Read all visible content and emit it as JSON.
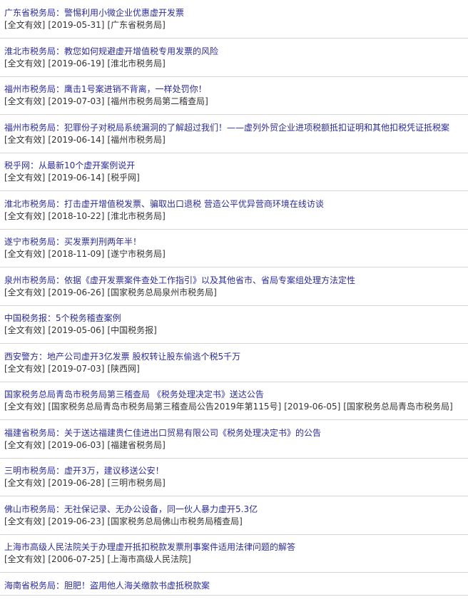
{
  "items": [
    {
      "title": "广东省税务局：警惕利用小微企业优惠虚开发票",
      "status": "[全文有效]",
      "date": "[2019-05-31]",
      "source": "[广东省税务局]"
    },
    {
      "title": "淮北市税务局：教您如何规避虚开增值税专用发票的风险",
      "status": "[全文有效]",
      "date": "[2019-06-19]",
      "source": "[淮北市税务局]"
    },
    {
      "title": "福州市税务局：鹰击1号案进销不背离，一样处罚你！",
      "status": "[全文有效]",
      "date": "[2019-07-03]",
      "source": "[福州市税务局第二稽查局]"
    },
    {
      "title": "福州市税务局：犯罪份子对税局系统漏洞的了解超过我们！——虚列外贸企业进项税额抵扣证明和其他扣税凭证抵税案",
      "status": "[全文有效]",
      "date": "[2019-06-14]",
      "source": "[福州市税务局]"
    },
    {
      "title": "税乎网：从最新10个虚开案例说开",
      "status": "[全文有效]",
      "date": "[2019-06-14]",
      "source": "[税乎网]"
    },
    {
      "title": "淮北市税务局：打击虚开增值税发票、骗取出口退税 营造公平优异营商环境在线访谈",
      "status": "[全文有效]",
      "date": "[2018-10-22]",
      "source": "[淮北市税务局]"
    },
    {
      "title": "遂宁市税务局：买发票判刑两年半！",
      "status": "[全文有效]",
      "date": "[2018-11-09]",
      "source": "[遂宁市税务局]"
    },
    {
      "title": "泉州市税务局：依据《虚开发票案件查处工作指引》以及其他省市、省局专案组处理方法定性",
      "status": "[全文有效]",
      "date": "[2019-06-26]",
      "source": "[国家税务总局泉州市税务局]"
    },
    {
      "title": "中国税务报：5个税务稽查案例",
      "status": "[全文有效]",
      "date": "[2019-05-06]",
      "source": "[中国税务报]"
    },
    {
      "title": "西安警方：地产公司虚开3亿发票 股权转让股东偷逃个税5千万",
      "status": "[全文有效]",
      "date": "[2019-07-03]",
      "source": "[陕西网]"
    },
    {
      "title": "国家税务总局青岛市税务局第三稽查局 《税务处理决定书》送达公告",
      "status": "[全文有效]",
      "extra": "[国家税务总局青岛市税务局第三稽查局公告2019年第115号]",
      "date": "[2019-06-05]",
      "source": "[国家税务总局青岛市税务局]"
    },
    {
      "title": "福建省税务局：关于送达福建贵仁佳进出口贸易有限公司《税务处理决定书》的公告",
      "status": "[全文有效]",
      "date": "[2019-06-03]",
      "source": "[福建省税务局]"
    },
    {
      "title": "三明市税务局：虚开3万，建议移送公安！",
      "status": "[全文有效]",
      "date": "[2019-06-28]",
      "source": "[三明市税务局]"
    },
    {
      "title": "佛山市税务局：无社保记录、无办公设备，同一伙人暴力虚开5.3亿",
      "status": "[全文有效]",
      "date": "[2019-06-23]",
      "source": "[国家税务总局佛山市税务局稽查局]"
    },
    {
      "title": "上海市高级人民法院关于办理虚开抵扣税款发票刑事案件适用法律问题的解答",
      "status": "[全文有效]",
      "date": "[2006-07-25]",
      "source": "[上海市高级人民法院]"
    },
    {
      "title": "海南省税务局：胆肥！盗用他人海关缴款书虚抵税款案",
      "status": "",
      "date": "",
      "source": ""
    }
  ]
}
